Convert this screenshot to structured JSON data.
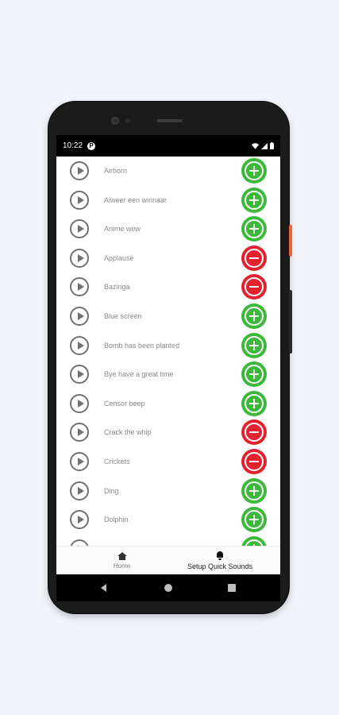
{
  "status_bar": {
    "time": "10:22",
    "notification_icon": "P"
  },
  "sounds": [
    {
      "name": "Airhorn",
      "action": "add"
    },
    {
      "name": "Alweer een winnaar",
      "action": "add"
    },
    {
      "name": "Anime wow",
      "action": "add"
    },
    {
      "name": "Applause",
      "action": "remove"
    },
    {
      "name": "Bazinga",
      "action": "remove"
    },
    {
      "name": "Blue screen",
      "action": "add"
    },
    {
      "name": "Bomb has been planted",
      "action": "add"
    },
    {
      "name": "Bye have a great time",
      "action": "add"
    },
    {
      "name": "Censor beep",
      "action": "add"
    },
    {
      "name": "Crack the whip",
      "action": "remove"
    },
    {
      "name": "Crickets",
      "action": "remove"
    },
    {
      "name": "Ding",
      "action": "add"
    },
    {
      "name": "Dolphin",
      "action": "add"
    },
    {
      "name": "",
      "action": "add"
    }
  ],
  "bottom_nav": {
    "home_label": "Home",
    "setup_label": "Setup Quick Sounds"
  },
  "colors": {
    "add": "#3cb83a",
    "remove": "#e6212e",
    "background": "#f1f5f9"
  }
}
